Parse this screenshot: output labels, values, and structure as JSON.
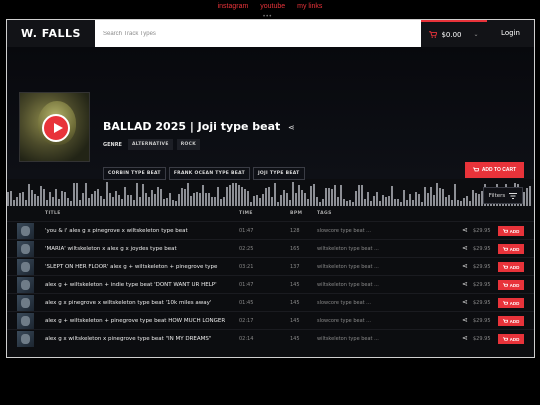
{
  "top_links": [
    "instagram",
    "youtube",
    "my links"
  ],
  "nav": {
    "logo": "W. FALLS",
    "search_placeholder": "Search Track Types",
    "cart_total": "$0.00",
    "login_label": "Login"
  },
  "hero": {
    "title": "BALLAD 2025 | Joji type beat",
    "genre_label": "GENRE",
    "genres": [
      "ALTERNATIVE",
      "ROCK"
    ],
    "tags": [
      "CORBIN TYPE BEAT",
      "FRANK OCEAN TYPE BEAT",
      "JOJI TYPE BEAT"
    ],
    "add_to_cart_label": "ADD TO CART"
  },
  "filters_label": "Filters",
  "table": {
    "headers": {
      "title": "TITLE",
      "time": "TIME",
      "bpm": "BPM",
      "tags": "TAGS"
    },
    "add_label": "ADD",
    "rows": [
      {
        "title": "'you & i' ales g x pinegrove x wiltskeleton type beat",
        "time": "01:47",
        "bpm": "128",
        "tags": "slowcore type beat ...",
        "price": "$29.95"
      },
      {
        "title": "'MARIA' wiltskeleton x alex g x joydes type beat",
        "time": "02:25",
        "bpm": "165",
        "tags": "wiltskeleton type beat ...",
        "price": "$29.95"
      },
      {
        "title": "'SLEPT ON HER FLOOR' alex g + wiltskeleton + pinegrove type",
        "time": "03:21",
        "bpm": "137",
        "tags": "wiltskeleton type beat ...",
        "price": "$29.95"
      },
      {
        "title": "alex g + wiltskeleton + indie type beat 'DONT WANT UR HELP'",
        "time": "01:47",
        "bpm": "145",
        "tags": "wiltskeleton type beat ...",
        "price": "$29.95"
      },
      {
        "title": "alex g x pinegrove x wiltskeleton type beat '10k miles away'",
        "time": "01:45",
        "bpm": "145",
        "tags": "slowcore type beat ...",
        "price": "$29.95"
      },
      {
        "title": "alex g + wiltskeleton + pinegrove type beat HOW MUCH LONGER",
        "time": "02:17",
        "bpm": "145",
        "tags": "slowcore type beat ...",
        "price": "$29.95"
      },
      {
        "title": "alex g x wiltskeleton x pinegrove type beat \"IN MY DREAMS\"",
        "time": "02:14",
        "bpm": "145",
        "tags": "wiltskeleton type beat ...",
        "price": "$29.95"
      }
    ]
  }
}
